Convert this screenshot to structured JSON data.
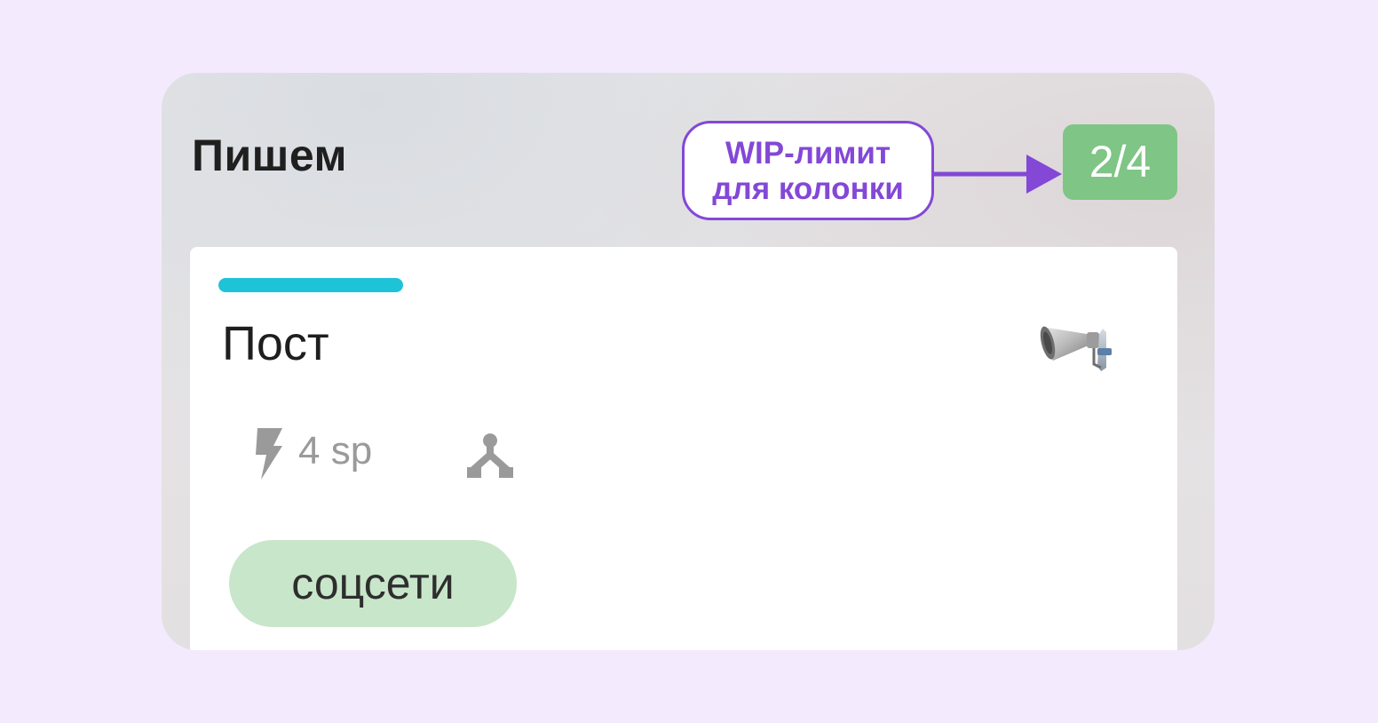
{
  "column": {
    "title": "Пишем",
    "wip_badge": "2/4"
  },
  "card": {
    "title": "Пост",
    "strip_color": "#1fc3d8",
    "story_points": "4 sp",
    "tag": "соцсети",
    "icons": [
      "megaphone-icon",
      "lightning-icon",
      "fork-icon"
    ]
  },
  "callout": {
    "line1": "WIP-лимит",
    "line2": "для колонки",
    "color": "#8348d6"
  },
  "colors": {
    "background": "#f3eafd",
    "wip_badge": "#7fc585",
    "tag": "#c8e6c9"
  }
}
